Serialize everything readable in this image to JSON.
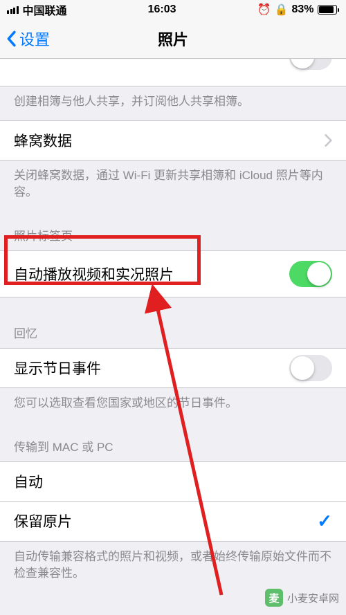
{
  "status": {
    "carrier": "中国联通",
    "time": "16:03",
    "battery_pct": "83%"
  },
  "nav": {
    "back_label": "设置",
    "title": "照片"
  },
  "row_shared_footer": "创建相簿与他人共享，并订阅他人共享相簿。",
  "row_cellular": {
    "label": "蜂窝数据"
  },
  "row_cellular_footer": "关闭蜂窝数据，通过 Wi-Fi 更新共享相簿和 iCloud 照片等内容。",
  "section_tab_header": "照片标签页",
  "row_autoplay": {
    "label": "自动播放视频和实况照片",
    "on": true
  },
  "section_memories_header": "回忆",
  "row_holiday": {
    "label": "显示节日事件",
    "on": false
  },
  "row_holiday_footer": "您可以选取查看您国家或地区的节日事件。",
  "section_transfer_header": "传输到 MAC 或 PC",
  "row_auto": {
    "label": "自动",
    "checked": false
  },
  "row_keep": {
    "label": "保留原片",
    "checked": true
  },
  "row_transfer_footer": "自动传输兼容格式的照片和视频，或者始终传输原始文件而不检查兼容性。",
  "watermark": "小麦安卓网"
}
